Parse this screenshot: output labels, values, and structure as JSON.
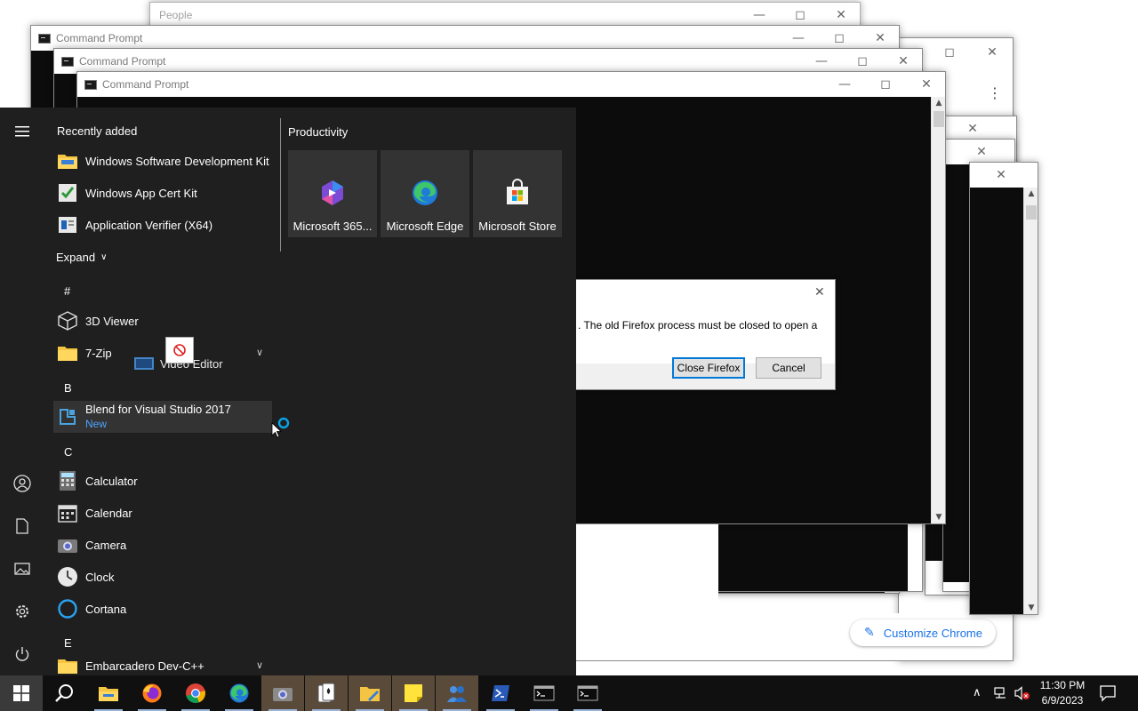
{
  "windows": {
    "people": {
      "title": "People"
    },
    "cmd1": {
      "title": "Command Prompt"
    },
    "cmd2": {
      "title": "Command Prompt"
    },
    "cmd3": {
      "title": "Command Prompt"
    }
  },
  "chrome": {
    "customize_label": "Customize Chrome"
  },
  "firefox_dialog": {
    "message": ". The old Firefox process must be closed to open a",
    "close_label": "Close Firefox",
    "cancel_label": "Cancel"
  },
  "start_menu": {
    "recently_added_heading": "Recently added",
    "recent": [
      {
        "label": "Windows Software Development Kit",
        "icon": "folder-icon"
      },
      {
        "label": "Windows App Cert Kit",
        "icon": "cert-kit-icon"
      },
      {
        "label": "Application Verifier (X64)",
        "icon": "app-verifier-icon"
      }
    ],
    "expand_label": "Expand",
    "letters": {
      "hash": "#",
      "b": "B",
      "c": "C",
      "e": "E"
    },
    "apps": {
      "viewer3d": "3D Viewer",
      "zip7": "7-Zip",
      "drag_label": "Video Editor",
      "blend": "Blend for Visual Studio 2017",
      "blend_badge": "New",
      "calculator": "Calculator",
      "calendar": "Calendar",
      "camera": "Camera",
      "clock": "Clock",
      "cortana": "Cortana",
      "embarcadero": "Embarcadero Dev-C++"
    },
    "tiles_group": "Productivity",
    "tiles": {
      "m365": "Microsoft 365...",
      "edge": "Microsoft Edge",
      "store": "Microsoft Store"
    }
  },
  "taskbar": {
    "time": "11:30 PM",
    "date": "6/9/2023"
  },
  "colors": {
    "start_bg": "#1f1f1f",
    "taskbar_bg": "#101010",
    "accent_blue": "#0078d7",
    "folder_yellow": "#f4c542"
  }
}
